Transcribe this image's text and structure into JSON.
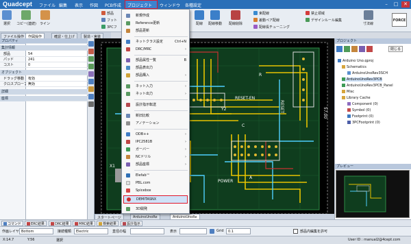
{
  "app": {
    "title": "Quadcept"
  },
  "menubar": [
    "ファイル",
    "編集",
    "表示",
    "作図",
    "PCB作成",
    "プロジェクト",
    "ウィンドウ",
    "各種設定"
  ],
  "active_menu": "プロジェクト",
  "window_buttons": [
    "–",
    "□",
    "✕"
  ],
  "ribbon": {
    "buttons": [
      "選択",
      "コピー(連続)",
      "ライン",
      "配線",
      "配線移動",
      "配線削除",
      "寸法線",
      "FORCE"
    ],
    "items": [
      "部品",
      "フット",
      "3PCフ",
      "束配線",
      "差動ペア配線",
      "配線長チューニング",
      "禁止領域",
      "デザインルール編集"
    ]
  },
  "left_tabs": [
    "ファイル操作",
    "作図操作",
    "確認・仕上げ",
    "製造・実装"
  ],
  "properties": {
    "header": "プロパティ",
    "sections": [
      {
        "title": "集計情報",
        "rows": [
          {
            "k": "部品",
            "v": "54"
          },
          {
            "k": "パッド",
            "v": "241"
          },
          {
            "k": "コスト",
            "v": "0"
          }
        ]
      },
      {
        "title": "オブジェクト",
        "rows": [
          {
            "k": "ドラッグ移動",
            "v": "有効"
          },
          {
            "k": "クロスプローブ",
            "v": "無効"
          }
        ]
      },
      {
        "title": "詳細",
        "rows": []
      },
      {
        "title": "座標",
        "rows": []
      }
    ]
  },
  "dropdown": {
    "items": [
      {
        "label": "新規作成",
        "shortcut": "",
        "sub": false
      },
      {
        "label": "Reference更新",
        "shortcut": "",
        "sub": false
      },
      {
        "label": "部品更新",
        "shortcut": "",
        "sub": false
      },
      {
        "label": "ネットクラス設定",
        "shortcut": "Ctrl+N",
        "sub": false
      },
      {
        "label": "DRC/MRC",
        "shortcut": "",
        "sub": true
      },
      {
        "label": "部品属性一覧",
        "shortcut": "B",
        "sub": false
      },
      {
        "label": "部品表出力",
        "shortcut": "",
        "sub": false
      },
      {
        "label": "部品購入",
        "shortcut": "",
        "sub": true
      },
      {
        "label": "ネット入力",
        "shortcut": "",
        "sub": true
      },
      {
        "label": "ネット出力",
        "shortcut": "",
        "sub": true
      },
      {
        "label": "設計指示転送",
        "shortcut": "",
        "sub": false
      },
      {
        "label": "新旧比較",
        "shortcut": "",
        "sub": false
      },
      {
        "label": "アノテーション",
        "shortcut": "",
        "sub": false
      },
      {
        "label": "ODB++",
        "shortcut": "",
        "sub": true
      },
      {
        "label": "IPC2581B",
        "shortcut": "",
        "sub": true
      },
      {
        "label": "ガーバー",
        "shortcut": "",
        "sub": true
      },
      {
        "label": "NCドリル",
        "shortcut": "",
        "sub": true
      },
      {
        "label": "部品座標",
        "shortcut": "",
        "sub": true
      },
      {
        "label": "Elefab™",
        "shortcut": "",
        "sub": false
      },
      {
        "label": "PBL.com",
        "shortcut": "",
        "sub": false
      },
      {
        "label": "Spicebox",
        "shortcut": "",
        "sub": false
      },
      {
        "label": "DEMITASNX",
        "shortcut": "",
        "sub": false
      },
      {
        "label": "3D開発",
        "shortcut": "",
        "sub": false
      }
    ],
    "highlighted": "DEMITASNX"
  },
  "project_panel": {
    "header": "プロジェクト",
    "close_label": "閉じる",
    "tree": [
      {
        "label": "Arduino Uno.qproj",
        "level": 0
      },
      {
        "label": "Schematics",
        "level": 1
      },
      {
        "label": "ArduinoUnoRev3SCH",
        "level": 2
      },
      {
        "label": "ArduinoUnoRev3PCB",
        "level": 1
      },
      {
        "label": "ArduinoUnoRev3PCB_Panel",
        "level": 1
      },
      {
        "label": "Misc",
        "level": 1
      },
      {
        "label": "Library Cache",
        "level": 1
      },
      {
        "label": "Component (0)",
        "level": 2
      },
      {
        "label": "Symbol (0)",
        "level": 2
      },
      {
        "label": "Footprint (0)",
        "level": 2
      },
      {
        "label": "3PCFootprint (0)",
        "level": 2
      }
    ]
  },
  "preview": {
    "header": "プレビュー"
  },
  "doc_tabs": [
    "スタートページ",
    "ArduinoUnoRe",
    "ArduinoUnoRe"
  ],
  "pcb_labels": [
    "RESET",
    "RESET-EN",
    "Y2",
    "57.00",
    "POWER",
    "X1",
    "C",
    "R",
    "A"
  ],
  "bottom_tabs": [
    "コマンド",
    "ERC結果",
    "DRC結果",
    "MRC結果",
    "検索結果",
    "設計指示"
  ],
  "props_bar": {
    "layer_label": "作画レイヤ",
    "layer_value": "Bottom",
    "conn_label": "接続種類",
    "conn_value": "Electric",
    "width_label": "直径の幅",
    "width_value": "",
    "display_label": "表示",
    "display_value": "",
    "grid_label": "Grid",
    "grid_value": "0.1",
    "part_label": "部品内編集を許可"
  },
  "status": {
    "x": "X:14.7",
    "y": "Y:56",
    "mode": "選択",
    "user": "User ID : manual2@4cept.com"
  },
  "colors": {
    "titlebar": "#2a6fb8",
    "highlight": "#e0162b",
    "board_green": "#0f5a2a",
    "trace_yellow": "#e8c400",
    "trace_cyan": "#4fd0ff"
  }
}
